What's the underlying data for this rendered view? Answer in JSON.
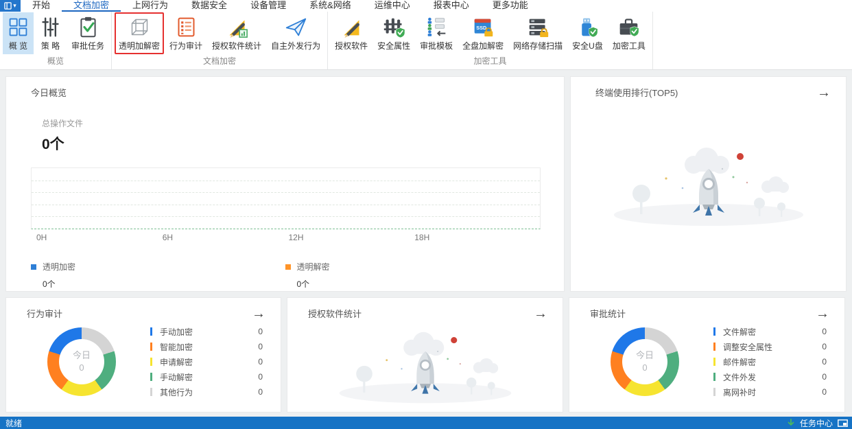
{
  "ui": {
    "caret": "▾",
    "arrow": "→"
  },
  "tabs": [
    {
      "label": "开始"
    },
    {
      "label": "文档加密",
      "active": true
    },
    {
      "label": "上网行为"
    },
    {
      "label": "数据安全"
    },
    {
      "label": "设备管理"
    },
    {
      "label": "系统&网络"
    },
    {
      "label": "运维中心"
    },
    {
      "label": "报表中心"
    },
    {
      "label": "更多功能"
    }
  ],
  "ribbon": {
    "groups": [
      {
        "label": "概览",
        "items": [
          {
            "label": "概 览",
            "icon": "overview-grid-icon",
            "sym": "#sym-grid",
            "selected": true
          },
          {
            "label": "策 略",
            "icon": "policy-sliders-icon",
            "sym": "#sym-sliders"
          },
          {
            "label": "审批任务",
            "icon": "approval-task-clipboard-icon",
            "sym": "#sym-clipboard"
          }
        ]
      },
      {
        "label": "文档加密",
        "items": [
          {
            "label": "透明加解密",
            "icon": "transparent-encrypt-cube-icon",
            "sym": "#sym-cube",
            "highlighted": true
          },
          {
            "label": "行为审计",
            "icon": "behavior-audit-list-icon",
            "sym": "#sym-list"
          },
          {
            "label": "授权软件统计",
            "icon": "authorized-software-stats-icon",
            "sym": "#sym-ruler-stat"
          },
          {
            "label": "自主外发行为",
            "icon": "outgoing-paper-plane-icon",
            "sym": "#sym-plane"
          }
        ]
      },
      {
        "label": "加密工具",
        "items": [
          {
            "label": "授权软件",
            "icon": "authorized-software-icon",
            "sym": "#sym-ruler"
          },
          {
            "label": "安全属性",
            "icon": "security-attribute-fence-icon",
            "sym": "#sym-fence"
          },
          {
            "label": "审批模板",
            "icon": "approval-template-icon",
            "sym": "#sym-org"
          },
          {
            "label": "全盘加解密",
            "icon": "full-disk-encrypt-ssd-icon",
            "sym": "#sym-ssd"
          },
          {
            "label": "网络存储扫描",
            "icon": "network-storage-scan-icon",
            "sym": "#sym-server"
          },
          {
            "label": "安全U盘",
            "icon": "secure-usb-icon",
            "sym": "#sym-usb"
          },
          {
            "label": "加密工具",
            "icon": "encrypt-toolbox-icon",
            "sym": "#sym-case"
          }
        ]
      }
    ]
  },
  "panels": {
    "today": {
      "title": "今日概览",
      "stat_label": "总操作文件",
      "stat_value": "0个",
      "chart": {
        "type": "line",
        "x_labels": [
          "0H",
          "6H",
          "12H",
          "18H"
        ],
        "series": [
          {
            "name": "透明加密",
            "color": "#2e7fd6",
            "values": []
          },
          {
            "name": "透明解密",
            "color": "#ff9429",
            "values": []
          }
        ]
      },
      "legends": [
        {
          "label": "透明加密",
          "color": "#2e7fd6",
          "value": "0个"
        },
        {
          "label": "透明解密",
          "color": "#ff9429",
          "value": "0个"
        }
      ]
    },
    "terminal_rank": {
      "title": "终端使用排行(TOP5)"
    },
    "behavior_audit": {
      "title": "行为审计",
      "donut": {
        "type": "donut",
        "center_label": "今日",
        "center_value": "0",
        "segments": [
          {
            "label": "手动加密",
            "color": "#1f78e8",
            "value": "0"
          },
          {
            "label": "智能加密",
            "color": "#ff8020",
            "value": "0"
          },
          {
            "label": "申请解密",
            "color": "#f6e430",
            "value": "0"
          },
          {
            "label": "手动解密",
            "color": "#4fae7f",
            "value": "0"
          },
          {
            "label": "其他行为",
            "color": "#d4d4d4",
            "value": "0"
          }
        ]
      }
    },
    "software_stats": {
      "title": "授权软件统计"
    },
    "approval_stats": {
      "title": "审批统计",
      "donut": {
        "type": "donut",
        "center_label": "今日",
        "center_value": "0",
        "segments": [
          {
            "label": "文件解密",
            "color": "#1f78e8",
            "value": "0"
          },
          {
            "label": "调整安全属性",
            "color": "#ff8020",
            "value": "0"
          },
          {
            "label": "邮件解密",
            "color": "#f6e430",
            "value": "0"
          },
          {
            "label": "文件外发",
            "color": "#4fae7f",
            "value": "0"
          },
          {
            "label": "离网补时",
            "color": "#d4d4d4",
            "value": "0"
          }
        ]
      }
    }
  },
  "status_bar": {
    "ready": "就绪",
    "task_center": "任务中心"
  }
}
